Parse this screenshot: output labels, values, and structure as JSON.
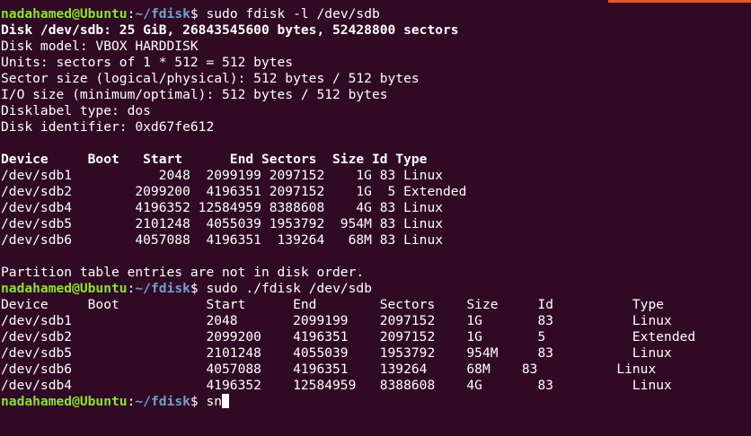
{
  "colors": {
    "background": "#300a24",
    "prompt_user": "#8ae234",
    "prompt_path": "#729fcf",
    "text": "#ffffff",
    "accent": "#e95420"
  },
  "prompt": {
    "user_host": "nadahamed@Ubuntu",
    "colon": ":",
    "path": "~/fdisk",
    "dollar": "$ "
  },
  "session": {
    "cmd1": "sudo fdisk -l /dev/sdb",
    "disk_header": "Disk /dev/sdb: 25 GiB, 26843545600 bytes, 52428800 sectors",
    "info": [
      "Disk model: VBOX HARDDISK",
      "Units: sectors of 1 * 512 = 512 bytes",
      "Sector size (logical/physical): 512 bytes / 512 bytes",
      "I/O size (minimum/optimal): 512 bytes / 512 bytes",
      "Disklabel type: dos",
      "Disk identifier: 0xd67fe612"
    ],
    "table1_header": "Device     Boot   Start      End Sectors  Size Id Type",
    "table1_rows": [
      "/dev/sdb1           2048  2099199 2097152    1G 83 Linux",
      "/dev/sdb2        2099200  4196351 2097152    1G  5 Extended",
      "/dev/sdb4        4196352 12584959 8388608    4G 83 Linux",
      "/dev/sdb5        2101248  4055039 1953792  954M 83 Linux",
      "/dev/sdb6        4057088  4196351  139264   68M 83 Linux"
    ],
    "warning": "Partition table entries are not in disk order.",
    "cmd2": "sudo ./fdisk /dev/sdb",
    "table2_header": "Device     Boot           Start      End        Sectors    Size     Id          Type",
    "table2_rows": [
      "/dev/sdb1                 2048       2099199    2097152    1G       83          Linux",
      "/dev/sdb2                 2099200    4196351    2097152    1G       5           Extended",
      "/dev/sdb5                 2101248    4055039    1953792    954M     83          Linux",
      "/dev/sdb6                 4057088    4196351    139264     68M    83          Linux",
      "/dev/sdb4                 4196352    12584959   8388608    4G       83          Linux"
    ],
    "cmd3": "sn"
  }
}
